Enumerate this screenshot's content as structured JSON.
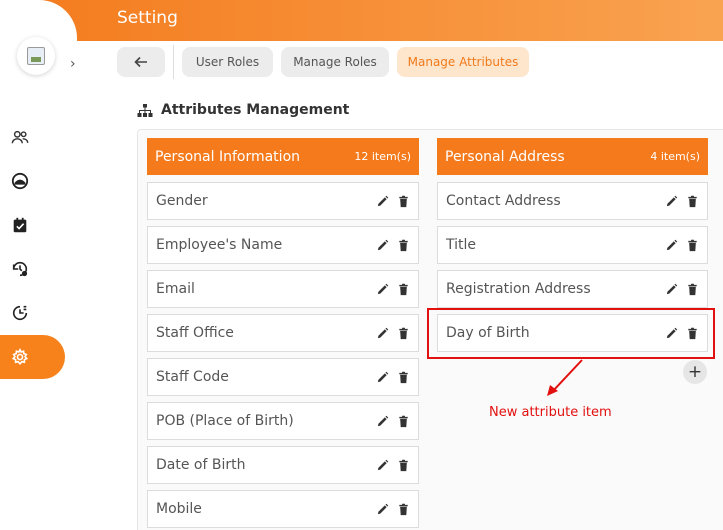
{
  "header": {
    "title": "Setting"
  },
  "sidebar": {
    "logo_icon": "broken-image-icon",
    "expand_icon": "chevron-right-icon",
    "items": [
      {
        "icon": "users-icon",
        "active": false
      },
      {
        "icon": "dashboard-gauge-icon",
        "active": false
      },
      {
        "icon": "calendar-check-icon",
        "active": false
      },
      {
        "icon": "history-settings-icon",
        "active": false
      },
      {
        "icon": "time-report-icon",
        "active": false
      },
      {
        "icon": "gear-icon",
        "active": true
      }
    ]
  },
  "toolbar": {
    "back_icon": "arrow-left-icon",
    "tabs": [
      {
        "label": "User Roles",
        "active": false
      },
      {
        "label": "Manage Roles",
        "active": false
      },
      {
        "label": "Manage Attributes",
        "active": true
      }
    ]
  },
  "main": {
    "section_title": "Attributes Management",
    "section_icon": "sitemap-icon",
    "columns": [
      {
        "name": "Personal Information",
        "count": "12 item(s)",
        "items": [
          "Gender",
          "Employee's Name",
          "Email",
          "Staff Office",
          "Staff Code",
          "POB (Place of Birth)",
          "Date of Birth",
          "Mobile"
        ]
      },
      {
        "name": "Personal Address",
        "count": "4 item(s)",
        "items": [
          "Contact Address",
          "Title",
          "Registration Address",
          "Day of Birth"
        ]
      }
    ],
    "add_button_label": "+"
  },
  "annotation": {
    "text": "New attribute item",
    "color": "#e31010"
  },
  "colors": {
    "accent": "#f47a1c",
    "active_tab_bg": "#fde6cc",
    "active_tab_text": "#f07a1c"
  }
}
